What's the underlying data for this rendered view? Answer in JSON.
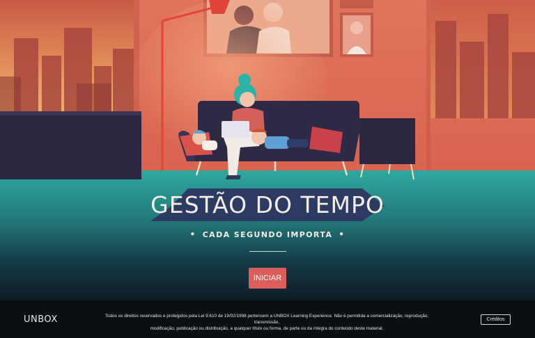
{
  "hero": {
    "title": "GESTÃO DO TEMPO",
    "subtitle": "CADA SEGUNDO IMPORTA",
    "start_label": "INICIAR"
  },
  "footer": {
    "logo": "UNBOX",
    "legal_line1": "Todos os direitos reservados e protegidos pela Lei 9.610 de 19/02/1998 pertencem a UNBOX Learning Experience. Não é permitida a comercialização, reprodução, transmissão,",
    "legal_line2": "modificação, publicação ou distribuição, a qualquer título ou forma, de parte ou da íntegra do conteúdo deste material.",
    "credits_label": "Créditos"
  },
  "colors": {
    "wall": "#d86b52",
    "floor": "#2a9f98",
    "accent_button": "#d95e5c",
    "footer": "#0a0f13"
  }
}
